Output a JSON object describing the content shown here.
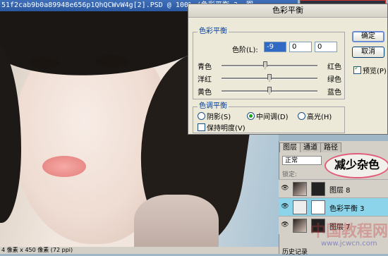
{
  "document": {
    "title": "51f2cab9b0a89948e656p1QhQCWvW4g[2].PSD @ 100% (色彩平衡 3, 图",
    "status": "4 像素 x 450 像素 (72 ppi)"
  },
  "dialog": {
    "title": "色彩平衡",
    "balance_group": {
      "legend": "色彩平衡",
      "levels_label": "色阶(L):",
      "levels": [
        "-9",
        "0",
        "0"
      ],
      "sliders": [
        {
          "left": "青色",
          "right": "红色",
          "value": -9
        },
        {
          "left": "洋红",
          "right": "绿色",
          "value": 0
        },
        {
          "left": "黄色",
          "right": "蓝色",
          "value": 0
        }
      ]
    },
    "tone_group": {
      "legend": "色调平衡",
      "options": [
        "阴影(S)",
        "中间调(D)",
        "高光(H)"
      ],
      "selected": "中间调(D)",
      "preserve_label": "保持明度(V)",
      "preserve_checked": false
    },
    "buttons": {
      "ok": "确定",
      "cancel": "取消"
    },
    "preview_label": "预览(P)",
    "preview_checked": true
  },
  "layers_panel": {
    "tabs": [
      "图层",
      "通道",
      "路径"
    ],
    "active_tab": "图层",
    "blend_mode": "正常",
    "lock_label": "锁定:",
    "annotation": "减少杂色",
    "layers": [
      {
        "name": "图层 8",
        "visible": true,
        "selected": false
      },
      {
        "name": "色彩平衡 3",
        "visible": true,
        "selected": true
      },
      {
        "name": "图层 7",
        "visible": true,
        "selected": false
      }
    ],
    "bottom_tab": "历史记录"
  },
  "watermark": {
    "text": "中国教程网",
    "url": "www.jcwcn.com"
  }
}
